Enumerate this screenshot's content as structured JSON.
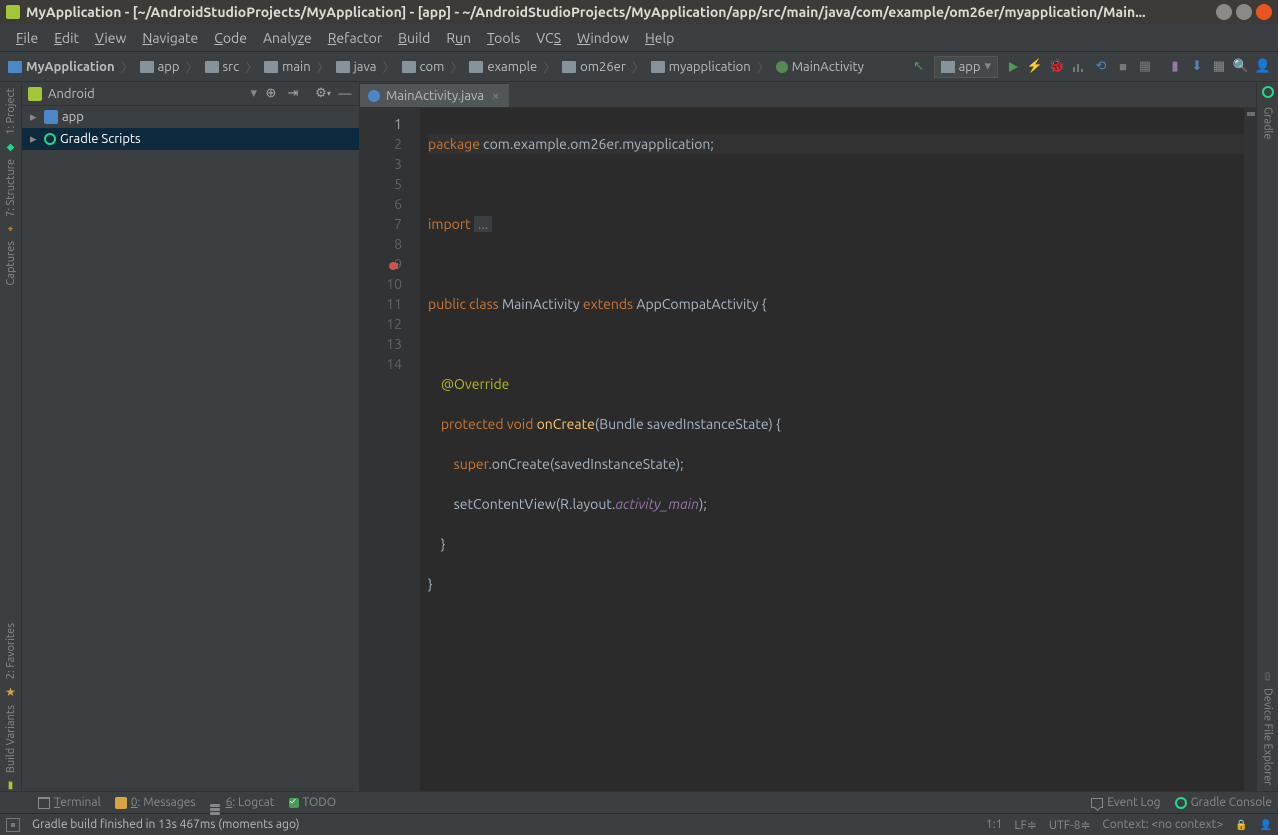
{
  "titlebar": {
    "title": "MyApplication - [~/AndroidStudioProjects/MyApplication] - [app] - ~/AndroidStudioProjects/MyApplication/app/src/main/java/com/example/om26er/myapplication/Main..."
  },
  "menubar": [
    "File",
    "Edit",
    "View",
    "Navigate",
    "Code",
    "Analyze",
    "Refactor",
    "Build",
    "Run",
    "Tools",
    "VCS",
    "Window",
    "Help"
  ],
  "breadcrumb": [
    {
      "label": "MyApplication",
      "type": "root"
    },
    {
      "label": "app",
      "type": "folder"
    },
    {
      "label": "src",
      "type": "folder"
    },
    {
      "label": "main",
      "type": "folder"
    },
    {
      "label": "java",
      "type": "folder"
    },
    {
      "label": "com",
      "type": "folder"
    },
    {
      "label": "example",
      "type": "folder"
    },
    {
      "label": "om26er",
      "type": "folder"
    },
    {
      "label": "myapplication",
      "type": "folder"
    },
    {
      "label": "MainActivity",
      "type": "class"
    }
  ],
  "run_config": "app",
  "project_panel": {
    "view": "Android",
    "items": [
      {
        "label": "app",
        "icon": "module"
      },
      {
        "label": "Gradle Scripts",
        "icon": "gradle",
        "selected": true
      }
    ]
  },
  "left_rail": [
    {
      "label": "1: Project",
      "icon": "project"
    },
    {
      "label": "7: Structure",
      "icon": "structure"
    },
    {
      "label": "Captures",
      "icon": "captures"
    },
    {
      "label": "2: Favorites",
      "icon": "favorites"
    },
    {
      "label": "Build Variants",
      "icon": "variants"
    }
  ],
  "right_rail": [
    {
      "label": "Gradle",
      "icon": "gradle"
    },
    {
      "label": "Device File Explorer",
      "icon": "device"
    }
  ],
  "editor": {
    "tab": "MainActivity.java",
    "lines": [
      1,
      2,
      3,
      5,
      6,
      7,
      8,
      9,
      10,
      11,
      12,
      13,
      14
    ],
    "override_marker_line": 9,
    "code": {
      "l1_kw": "package",
      "l1_rest": " com.example.om26er.myapplication;",
      "l3_kw": "import",
      "l3_fold": "...",
      "l6_pub": "public ",
      "l6_cls": "class ",
      "l6_name": "MainActivity ",
      "l6_ext": "extends ",
      "l6_sup": "AppCompatActivity ",
      "l6_brace": "{",
      "l8_ann": "@Override",
      "l9_prot": "protected ",
      "l9_void": "void ",
      "l9_fn": "onCreate",
      "l9_sig": "(Bundle savedInstanceState) {",
      "l10_sup": "super",
      "l10_rest": ".onCreate(savedInstanceState);",
      "l11_a": "setContentView(R.layout.",
      "l11_field": "activity_main",
      "l11_b": ");",
      "l12": "}",
      "l13": "}"
    }
  },
  "bottom_tabs": [
    {
      "label": "Terminal",
      "icon": "terminal"
    },
    {
      "label": "0: Messages",
      "icon": "messages"
    },
    {
      "label": "6: Logcat",
      "icon": "logcat"
    },
    {
      "label": "TODO",
      "icon": "todo"
    }
  ],
  "bottom_right": [
    {
      "label": "Event Log",
      "icon": "eventlog"
    },
    {
      "label": "Gradle Console",
      "icon": "gradleconsole"
    }
  ],
  "statusbar": {
    "message": "Gradle build finished in 13s 467ms (moments ago)",
    "pos": "1:1",
    "lf": "LF",
    "enc": "UTF-8",
    "ctx": "Context: <no context>"
  }
}
